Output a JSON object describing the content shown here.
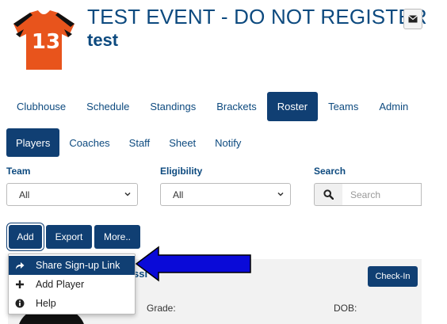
{
  "header": {
    "jersey_number": "13",
    "title": "TEST EVENT - DO NOT REGISTER",
    "subtitle": "test",
    "mail_icon": "envelope-icon"
  },
  "main_nav": {
    "items": [
      "Clubhouse",
      "Schedule",
      "Standings",
      "Brackets",
      "Roster",
      "Teams",
      "Admin"
    ],
    "active": "Roster"
  },
  "sub_nav": {
    "items": [
      "Players",
      "Coaches",
      "Staff",
      "Sheet",
      "Notify"
    ],
    "active": "Players"
  },
  "filters": {
    "team_label": "Team",
    "team_value": "All",
    "eligibility_label": "Eligibility",
    "eligibility_value": "All",
    "search_label": "Search",
    "search_placeholder": "Search"
  },
  "actions": {
    "add": "Add",
    "export": "Export",
    "more": "More.."
  },
  "dropdown": {
    "items": [
      {
        "label": "Share Sign-up Link",
        "icon": "share-icon"
      },
      {
        "label": "Add Player",
        "icon": "plus-icon"
      },
      {
        "label": "Help",
        "icon": "info-icon"
      }
    ]
  },
  "player_card": {
    "name_fragment": "ssi",
    "checkin": "Check-In",
    "grade_label": "Grade:",
    "dob_label": "DOB:"
  },
  "colors": {
    "primary": "#103f73",
    "title": "#0d4a7f",
    "jersey": "#e8541c",
    "arrow": "#0a0ad8"
  }
}
